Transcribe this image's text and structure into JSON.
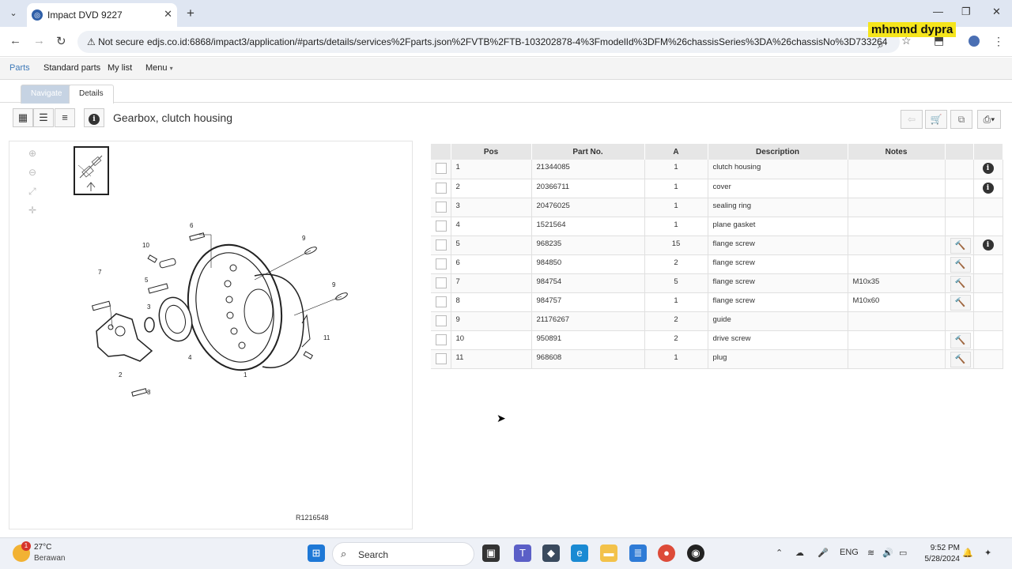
{
  "browser": {
    "tab_title": "Impact DVD 9227",
    "security_label": "Not secure",
    "url": "edjs.co.id:6868/impact3/application/#parts/details/services%2Fparts.json%2FVTB%2FTB-103202878-4%3FmodelId%3DFM%26chassisSeries%3DA%26chassisNo%3D733264",
    "watermark": "mhmmd dypra"
  },
  "menu": {
    "parts": "Parts",
    "standard_parts": "Standard parts",
    "my_list": "My list",
    "menu": "Menu"
  },
  "subtabs": {
    "navigate": "Navigate",
    "details": "Details"
  },
  "page": {
    "title": "Gearbox, clutch housing"
  },
  "illustration": {
    "drawing_ref": "R1216548",
    "callouts": [
      "1",
      "2",
      "3",
      "4",
      "5",
      "6",
      "7",
      "8",
      "9",
      "9",
      "10",
      "11"
    ]
  },
  "table": {
    "headers": {
      "pos": "Pos",
      "part_no": "Part No.",
      "a": "A",
      "description": "Description",
      "notes": "Notes"
    },
    "rows": [
      {
        "pos": "1",
        "part_no": "21344085",
        "a": "1",
        "description": "clutch housing",
        "notes": "",
        "tool": false,
        "info": true
      },
      {
        "pos": "2",
        "part_no": "20366711",
        "a": "1",
        "description": "cover",
        "notes": "",
        "tool": false,
        "info": true
      },
      {
        "pos": "3",
        "part_no": "20476025",
        "a": "1",
        "description": "sealing ring",
        "notes": "",
        "tool": false,
        "info": false
      },
      {
        "pos": "4",
        "part_no": "1521564",
        "a": "1",
        "description": "plane gasket",
        "notes": "",
        "tool": false,
        "info": false
      },
      {
        "pos": "5",
        "part_no": "968235",
        "a": "15",
        "description": "flange screw",
        "notes": "",
        "tool": true,
        "info": true
      },
      {
        "pos": "6",
        "part_no": "984850",
        "a": "2",
        "description": "flange screw",
        "notes": "",
        "tool": true,
        "info": false
      },
      {
        "pos": "7",
        "part_no": "984754",
        "a": "5",
        "description": "flange screw",
        "notes": "M10x35",
        "tool": true,
        "info": false
      },
      {
        "pos": "8",
        "part_no": "984757",
        "a": "1",
        "description": "flange screw",
        "notes": "M10x60",
        "tool": true,
        "info": false
      },
      {
        "pos": "9",
        "part_no": "21176267",
        "a": "2",
        "description": "guide",
        "notes": "",
        "tool": false,
        "info": false
      },
      {
        "pos": "10",
        "part_no": "950891",
        "a": "2",
        "description": "drive screw",
        "notes": "",
        "tool": true,
        "info": false
      },
      {
        "pos": "11",
        "part_no": "968608",
        "a": "1",
        "description": "plug",
        "notes": "",
        "tool": true,
        "info": false
      }
    ]
  },
  "taskbar": {
    "weather_badge": "1",
    "temperature": "27°C",
    "weather_desc": "Berawan",
    "search_label": "Search",
    "lang": "ENG",
    "time": "9:52 PM",
    "date": "5/28/2024"
  }
}
